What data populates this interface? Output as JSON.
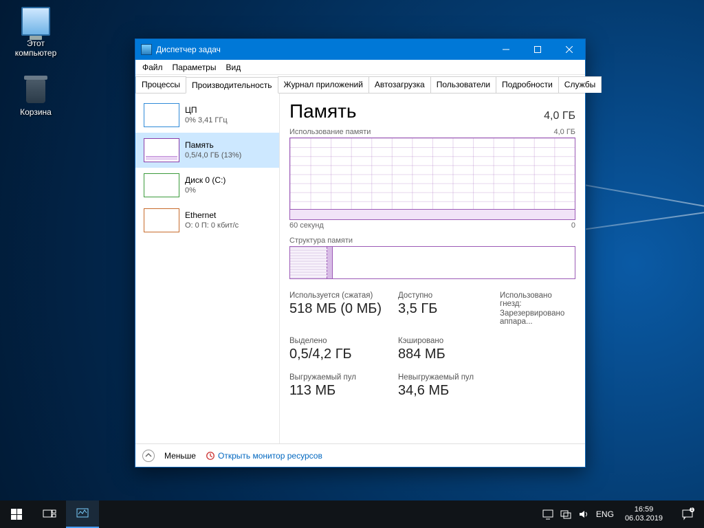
{
  "desktop": {
    "icons": [
      {
        "name": "this-pc",
        "label": "Этот компьютер"
      },
      {
        "name": "recycle-bin",
        "label": "Корзина"
      }
    ]
  },
  "window": {
    "title": "Диспетчер задач",
    "menu": {
      "file": "Файл",
      "options": "Параметры",
      "view": "Вид"
    },
    "tabs": {
      "processes": "Процессы",
      "performance": "Производительность",
      "app_history": "Журнал приложений",
      "startup": "Автозагрузка",
      "users": "Пользователи",
      "details": "Подробности",
      "services": "Службы",
      "active": "performance"
    }
  },
  "sidebar": {
    "cpu": {
      "title": "ЦП",
      "sub": "0% 3,41 ГГц"
    },
    "memory": {
      "title": "Память",
      "sub": "0,5/4,0 ГБ (13%)"
    },
    "disk": {
      "title": "Диск 0 (C:)",
      "sub": "0%"
    },
    "ethernet": {
      "title": "Ethernet",
      "sub": "О: 0 П: 0 кбит/с"
    },
    "selected": "memory"
  },
  "detail": {
    "title": "Память",
    "total": "4,0 ГБ",
    "usage_label": "Использование памяти",
    "usage_max": "4,0 ГБ",
    "xaxis_left": "60 секунд",
    "xaxis_right": "0",
    "structure_label": "Структура памяти",
    "stats": {
      "used_label": "Используется (сжатая)",
      "used_value": "518 МБ (0 МБ)",
      "avail_label": "Доступно",
      "avail_value": "3,5 ГБ",
      "slots_label": "Использовано гнезд:",
      "slots_value": "Зарезервировано аппара...",
      "commit_label": "Выделено",
      "commit_value": "0,5/4,2 ГБ",
      "cache_label": "Кэшировано",
      "cache_value": "884 МБ",
      "paged_label": "Выгружаемый пул",
      "paged_value": "113 МБ",
      "nonpaged_label": "Невыгружаемый пул",
      "nonpaged_value": "34,6 МБ"
    }
  },
  "footer": {
    "fewer": "Меньше",
    "open_monitor": "Открыть монитор ресурсов"
  },
  "taskbar": {
    "tray": {
      "lang": "ENG",
      "time": "16:59",
      "date": "06.03.2019",
      "notif_count": "1"
    }
  },
  "chart_data": {
    "type": "area",
    "title": "Использование памяти",
    "ylabel": "ГБ",
    "ylim": [
      0,
      4.0
    ],
    "xlabel": "секунд",
    "xlim": [
      60,
      0
    ],
    "x": [
      60,
      0
    ],
    "series": [
      {
        "name": "Память",
        "values": [
          0.5,
          0.5
        ]
      }
    ]
  }
}
